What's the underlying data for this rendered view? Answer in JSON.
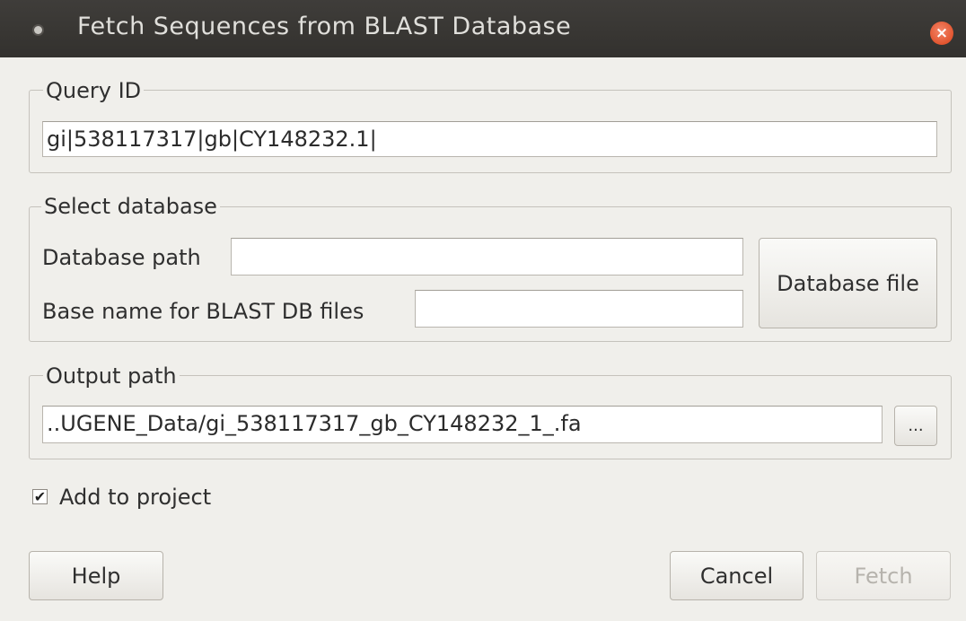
{
  "window": {
    "title": "Fetch Sequences from BLAST Database",
    "close_glyph": "×"
  },
  "query_group": {
    "label": "Query ID",
    "value": "gi|538117317|gb|CY148232.1|"
  },
  "database_group": {
    "label": "Select database",
    "db_path_label": "Database path",
    "db_path_value": "",
    "base_name_label": "Base name for BLAST DB files",
    "base_name_value": "",
    "db_file_button": "Database file"
  },
  "output_group": {
    "label": "Output path",
    "value": "..UGENE_Data/gi_538117317_gb_CY148232_1_.fa",
    "browse_button": "..."
  },
  "add_to_project": {
    "label": "Add to project",
    "checked": true,
    "check_glyph": "✔"
  },
  "buttons": {
    "help": "Help",
    "cancel": "Cancel",
    "fetch": "Fetch"
  }
}
